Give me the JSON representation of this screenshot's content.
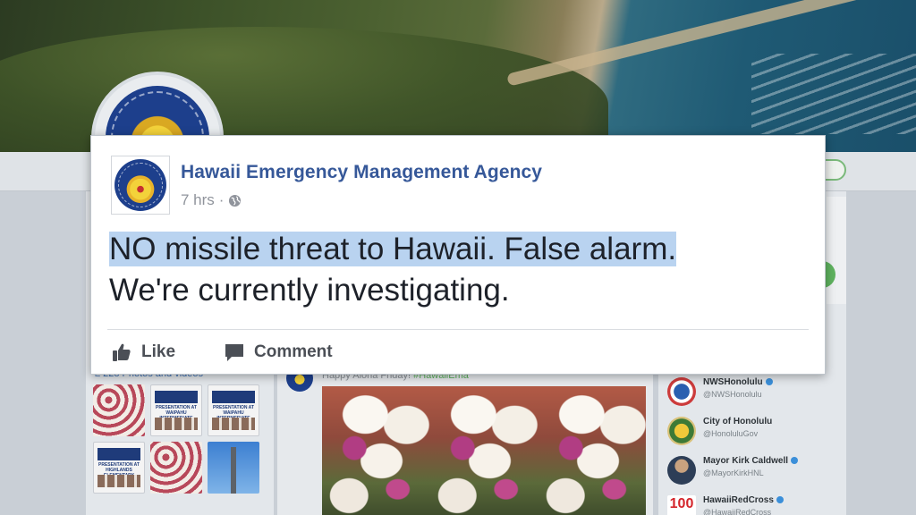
{
  "background": {
    "photos_header": "≥ 228 Photos and videos",
    "tweet_snippet": "Happy Aloha Friday! ",
    "tweet_hashtag": "#HawaiiEma",
    "flyers": [
      "PRESENTATION AT WAIPAHU INTERMEDIATE SCHOOL",
      "PRESENTATION AT WAIPAHU INTERMEDIATE SCHOOL",
      "PRESENTATION AT HIGHLANDS ELEMENTARY SCHOOL"
    ],
    "who_to_follow": [
      {
        "name": "NWSHonolulu",
        "handle": "@NWSHonolulu",
        "verified": true,
        "icon": "nws-logo"
      },
      {
        "name": "City of Honolulu",
        "handle": "@HonoluluGov",
        "verified": false,
        "icon": "city-seal"
      },
      {
        "name": "Mayor Kirk Caldwell",
        "handle": "@MayorKirkHNL",
        "verified": true,
        "icon": "mayor-photo"
      },
      {
        "name": "HawaiiRedCross",
        "handle": "@HawaiiRedCross",
        "verified": true,
        "icon": "red-cross-100-logo",
        "logo_text": "100"
      }
    ]
  },
  "post": {
    "page_name": "Hawaii Emergency Management Agency",
    "time": "7 hrs",
    "separator": "·",
    "audience_icon": "globe-icon",
    "text_line1": "NO missile threat to Hawaii. False alarm.",
    "text_line2": "We're currently investigating.",
    "like_label": "Like",
    "comment_label": "Comment",
    "colors": {
      "page_name": "#365899",
      "highlight": "#b9d3f0",
      "text": "#1d2129",
      "meta": "#90949c"
    }
  }
}
